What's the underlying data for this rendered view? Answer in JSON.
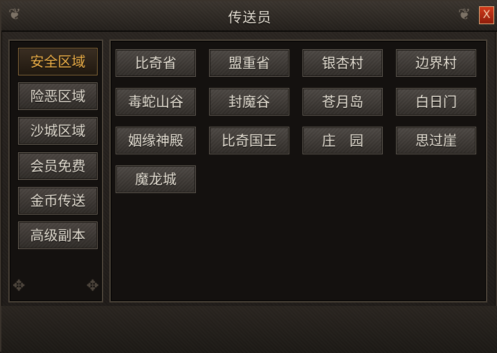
{
  "window": {
    "title": "传送员",
    "close_label": "X"
  },
  "colors": {
    "active_text": "#f0b24a",
    "button_text": "#e8e2d6",
    "close_button": "#c0301a"
  },
  "categories": [
    {
      "label": "安全区域",
      "active": true
    },
    {
      "label": "险恶区域",
      "active": false
    },
    {
      "label": "沙城区域",
      "active": false
    },
    {
      "label": "会员免费",
      "active": false
    },
    {
      "label": "金币传送",
      "active": false
    },
    {
      "label": "高级副本",
      "active": false
    }
  ],
  "destinations": [
    "比奇省",
    "盟重省",
    "银杏村",
    "边界村",
    "毒蛇山谷",
    "封魔谷",
    "苍月岛",
    "白日门",
    "姻缘神殿",
    "比奇国王",
    "庄　园",
    "思过崖",
    "魔龙城"
  ]
}
